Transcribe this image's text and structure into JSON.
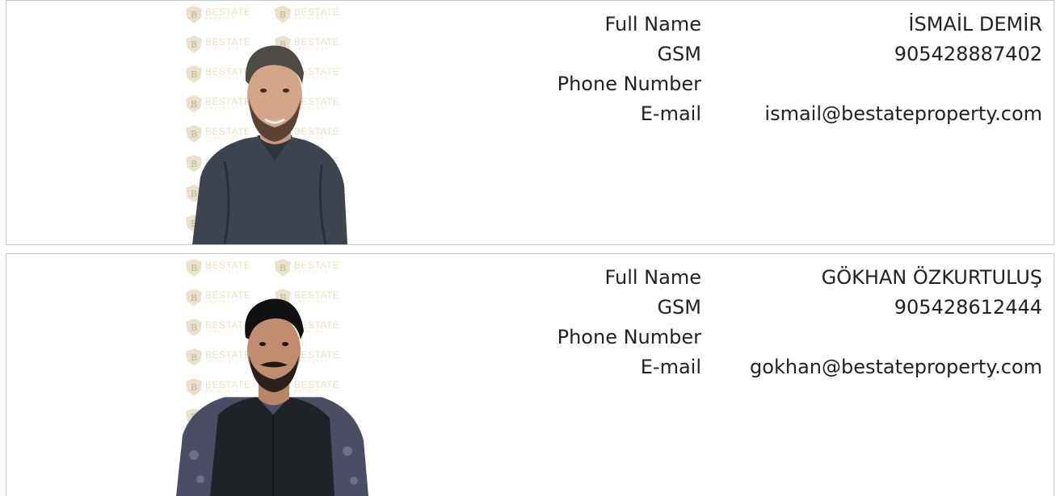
{
  "labels": {
    "full_name": "Full Name",
    "gsm": "GSM",
    "phone": "Phone Number",
    "email": "E-mail"
  },
  "watermark": {
    "brand": "BESTATE",
    "sub": "PROPERTY",
    "letter": "B"
  },
  "agents": [
    {
      "full_name": "İSMAİL DEMİR",
      "gsm": "905428887402",
      "phone": "",
      "email": "ismail@bestateproperty.com"
    },
    {
      "full_name": "GÖKHAN ÖZKURTULUŞ",
      "gsm": "905428612444",
      "phone": "",
      "email": "gokhan@bestateproperty.com"
    }
  ],
  "colors": {
    "border": "#c8c8c8",
    "watermark_gold": "#e9dcb4",
    "text": "#222222"
  }
}
